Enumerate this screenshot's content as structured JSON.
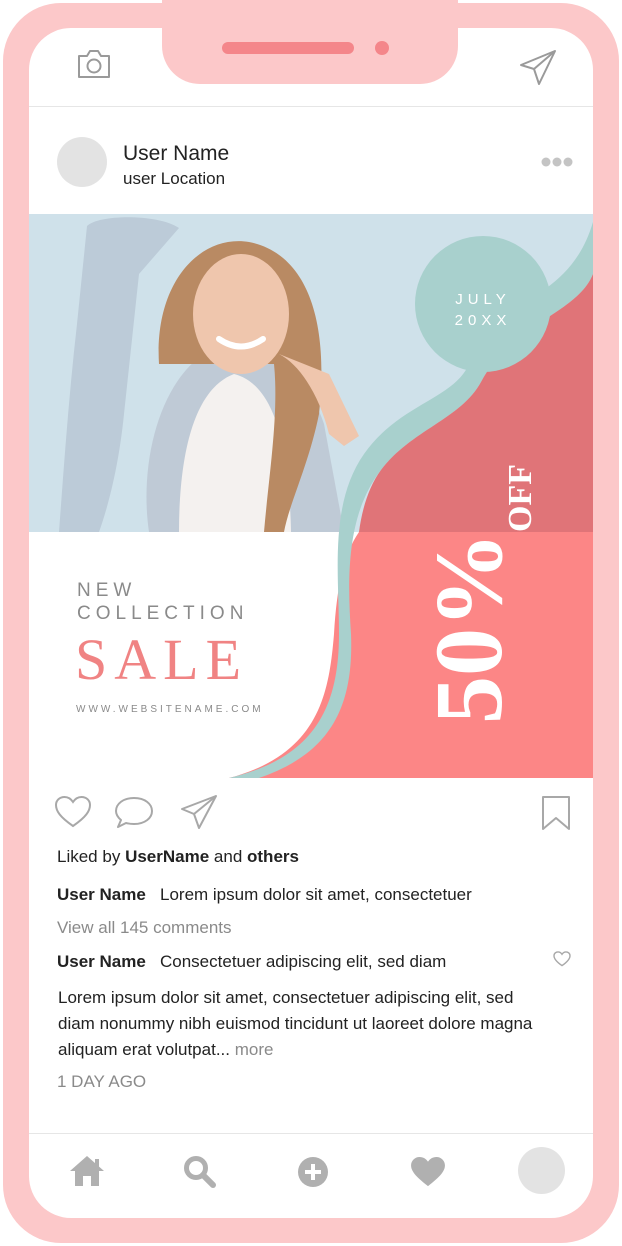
{
  "post": {
    "user_name": "User Name",
    "user_location": "user Location",
    "ad": {
      "month": "JULY",
      "year": "20XX",
      "line1": "NEW",
      "line2": "COLLECTION",
      "headline": "SALE",
      "website": "WWW.WEBSITENAME.COM",
      "discount": "50%",
      "off": "OFF"
    }
  },
  "likes": {
    "prefix": "Liked by",
    "user": "UserName",
    "and": "and",
    "others": "others"
  },
  "comments": [
    {
      "user": "User Name",
      "text": "Lorem ipsum dolor sit amet, consectetuer"
    },
    {
      "user": "User Name",
      "text": "Consectetuer adipiscing elit, sed diam"
    }
  ],
  "view_all": "View all 145 comments",
  "caption": "Lorem ipsum dolor sit amet, consectetuer adipiscing elit, sed diam nonummy nibh euismod tincidunt ut laoreet dolore magna aliquam erat volutpat...",
  "more": "more",
  "time": "1 DAY AGO",
  "colors": {
    "frame": "#fcc8c9",
    "accent_pink": "#f4868a",
    "coral": "#fc8686",
    "teal": "#a8d0cd",
    "icon_gray": "#b0b0b0"
  },
  "icons": [
    "camera-icon",
    "send-icon",
    "more-icon",
    "heart-icon",
    "comment-icon",
    "share-icon",
    "bookmark-icon",
    "home-icon",
    "search-icon",
    "add-icon",
    "activity-icon"
  ]
}
